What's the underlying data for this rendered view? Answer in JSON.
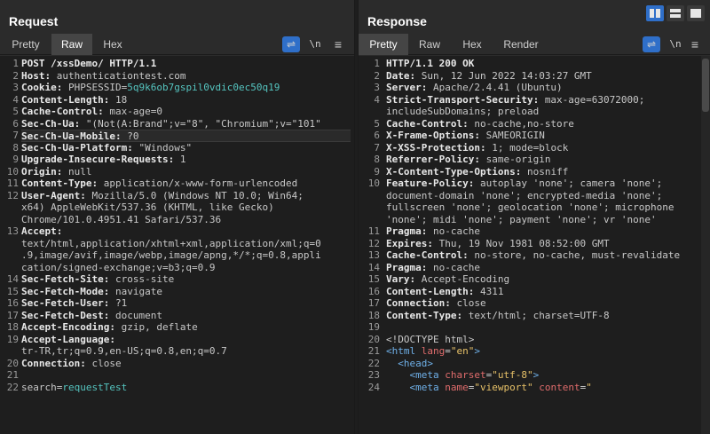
{
  "request": {
    "title": "Request",
    "tabs": [
      "Pretty",
      "Raw",
      "Hex"
    ],
    "active_tab": "Raw",
    "newline_label": "\\n",
    "menu_label": "≡",
    "lines": [
      {
        "n": "1",
        "name": "POST /xssDemo/ HTTP/1.1",
        "sep": "",
        "value": ""
      },
      {
        "n": "2",
        "name": "Host:",
        "sep": " ",
        "value": "authenticationtest.com"
      },
      {
        "n": "3",
        "name": "Cookie:",
        "sep": " ",
        "value": "PHPSESSID=",
        "extra": "5q9k6ob7gspil0vdic0ec50q19"
      },
      {
        "n": "4",
        "name": "Content-Length:",
        "sep": " ",
        "value": "18"
      },
      {
        "n": "5",
        "name": "Cache-Control:",
        "sep": " ",
        "value": "max-age=0"
      },
      {
        "n": "6",
        "name": "Sec-Ch-Ua:",
        "sep": " ",
        "value": "\"(Not(A:Brand\";v=\"8\", \"Chromium\";v=\"101\""
      },
      {
        "n": "7",
        "name": "Sec-Ch-Ua-Mobile:",
        "sep": " ",
        "value": "?0"
      },
      {
        "n": "8",
        "name": "Sec-Ch-Ua-Platform:",
        "sep": " ",
        "value": "\"Windows\""
      },
      {
        "n": "9",
        "name": "Upgrade-Insecure-Requests:",
        "sep": " ",
        "value": "1"
      },
      {
        "n": "10",
        "name": "Origin:",
        "sep": " ",
        "value": "null"
      },
      {
        "n": "11",
        "name": "Content-Type:",
        "sep": " ",
        "value": "application/x-www-form-urlencoded"
      },
      {
        "n": "12",
        "name": "User-Agent:",
        "sep": " ",
        "value": "Mozilla/5.0 (Windows NT 10.0; Win64;"
      },
      {
        "n": "",
        "name": "",
        "sep": "",
        "value": "x64) AppleWebKit/537.36 (KHTML, like Gecko)"
      },
      {
        "n": "",
        "name": "",
        "sep": "",
        "value": "Chrome/101.0.4951.41 Safari/537.36"
      },
      {
        "n": "13",
        "name": "Accept:",
        "sep": "",
        "value": ""
      },
      {
        "n": "",
        "name": "",
        "sep": "",
        "value": "text/html,application/xhtml+xml,application/xml;q=0"
      },
      {
        "n": "",
        "name": "",
        "sep": "",
        "value": ".9,image/avif,image/webp,image/apng,*/*;q=0.8,appli"
      },
      {
        "n": "",
        "name": "",
        "sep": "",
        "value": "cation/signed-exchange;v=b3;q=0.9"
      },
      {
        "n": "14",
        "name": "Sec-Fetch-Site:",
        "sep": " ",
        "value": "cross-site"
      },
      {
        "n": "15",
        "name": "Sec-Fetch-Mode:",
        "sep": " ",
        "value": "navigate"
      },
      {
        "n": "16",
        "name": "Sec-Fetch-User:",
        "sep": " ",
        "value": "?1"
      },
      {
        "n": "17",
        "name": "Sec-Fetch-Dest:",
        "sep": " ",
        "value": "document"
      },
      {
        "n": "18",
        "name": "Accept-Encoding:",
        "sep": " ",
        "value": "gzip, deflate"
      },
      {
        "n": "19",
        "name": "Accept-Language:",
        "sep": "",
        "value": ""
      },
      {
        "n": "",
        "name": "",
        "sep": "",
        "value": "tr-TR,tr;q=0.9,en-US;q=0.8,en;q=0.7"
      },
      {
        "n": "20",
        "name": "Connection:",
        "sep": " ",
        "value": "close"
      },
      {
        "n": "21",
        "name": "",
        "sep": "",
        "value": ""
      },
      {
        "n": "22",
        "name": "",
        "sep": "",
        "value": "search=",
        "extra": "requestTest"
      }
    ]
  },
  "response": {
    "title": "Response",
    "tabs": [
      "Pretty",
      "Raw",
      "Hex",
      "Render"
    ],
    "active_tab": "Pretty",
    "newline_label": "\\n",
    "menu_label": "≡",
    "lines": [
      {
        "n": "1",
        "name": "HTTP/1.1 200 OK",
        "sep": "",
        "value": ""
      },
      {
        "n": "2",
        "name": "Date:",
        "sep": " ",
        "value": "Sun, 12 Jun 2022 14:03:27 GMT"
      },
      {
        "n": "3",
        "name": "Server:",
        "sep": " ",
        "value": "Apache/2.4.41 (Ubuntu)"
      },
      {
        "n": "4",
        "name": "Strict-Transport-Security:",
        "sep": " ",
        "value": "max-age=63072000;"
      },
      {
        "n": "",
        "name": "",
        "sep": "",
        "value": "includeSubDomains; preload"
      },
      {
        "n": "5",
        "name": "Cache-Control:",
        "sep": " ",
        "value": "no-cache,no-store"
      },
      {
        "n": "6",
        "name": "X-Frame-Options:",
        "sep": " ",
        "value": "SAMEORIGIN"
      },
      {
        "n": "7",
        "name": "X-XSS-Protection:",
        "sep": " ",
        "value": "1; mode=block"
      },
      {
        "n": "8",
        "name": "Referrer-Policy:",
        "sep": " ",
        "value": "same-origin"
      },
      {
        "n": "9",
        "name": "X-Content-Type-Options:",
        "sep": " ",
        "value": "nosniff"
      },
      {
        "n": "10",
        "name": "Feature-Policy:",
        "sep": " ",
        "value": "autoplay 'none'; camera 'none';"
      },
      {
        "n": "",
        "name": "",
        "sep": "",
        "value": "document-domain 'none'; encrypted-media 'none';"
      },
      {
        "n": "",
        "name": "",
        "sep": "",
        "value": "fullscreen 'none'; geolocation 'none'; microphone"
      },
      {
        "n": "",
        "name": "",
        "sep": "",
        "value": "'none'; midi 'none'; payment 'none'; vr 'none'"
      },
      {
        "n": "11",
        "name": "Pragma:",
        "sep": " ",
        "value": "no-cache"
      },
      {
        "n": "12",
        "name": "Expires:",
        "sep": " ",
        "value": "Thu, 19 Nov 1981 08:52:00 GMT"
      },
      {
        "n": "13",
        "name": "Cache-Control:",
        "sep": " ",
        "value": "no-store, no-cache, must-revalidate"
      },
      {
        "n": "14",
        "name": "Pragma:",
        "sep": " ",
        "value": "no-cache"
      },
      {
        "n": "15",
        "name": "Vary:",
        "sep": " ",
        "value": "Accept-Encoding"
      },
      {
        "n": "16",
        "name": "Content-Length:",
        "sep": " ",
        "value": "4311"
      },
      {
        "n": "17",
        "name": "Connection:",
        "sep": " ",
        "value": "close"
      },
      {
        "n": "18",
        "name": "Content-Type:",
        "sep": " ",
        "value": "text/html; charset=UTF-8"
      },
      {
        "n": "19",
        "name": "",
        "sep": "",
        "value": ""
      },
      {
        "n": "20",
        "name": "",
        "sep": "",
        "value": "<!DOCTYPE html>"
      },
      {
        "n": "21",
        "html": [
          [
            "tag",
            "<html "
          ],
          [
            "attr",
            "lang"
          ],
          [
            "plain",
            "="
          ],
          [
            "str",
            "\"en\""
          ],
          [
            "tag",
            ">"
          ]
        ]
      },
      {
        "n": "22",
        "html": [
          [
            "plain",
            "  "
          ],
          [
            "tag",
            "<head>"
          ]
        ]
      },
      {
        "n": "23",
        "html": [
          [
            "plain",
            "    "
          ],
          [
            "tag",
            "<meta "
          ],
          [
            "attr",
            "charset"
          ],
          [
            "plain",
            "="
          ],
          [
            "str",
            "\"utf-8\""
          ],
          [
            "tag",
            ">"
          ]
        ]
      },
      {
        "n": "24",
        "html": [
          [
            "plain",
            "    "
          ],
          [
            "tag",
            "<meta "
          ],
          [
            "attr",
            "name"
          ],
          [
            "plain",
            "="
          ],
          [
            "str",
            "\"viewport\""
          ],
          [
            "plain",
            " "
          ],
          [
            "attr",
            "content"
          ],
          [
            "plain",
            "="
          ],
          [
            "str",
            "\""
          ]
        ]
      }
    ]
  },
  "colors": {
    "accent": "#2f6fc9",
    "cookie_value": "#55c5c0",
    "tag": "#6fb0e8",
    "attr": "#e06c6c",
    "string": "#e7c168"
  }
}
